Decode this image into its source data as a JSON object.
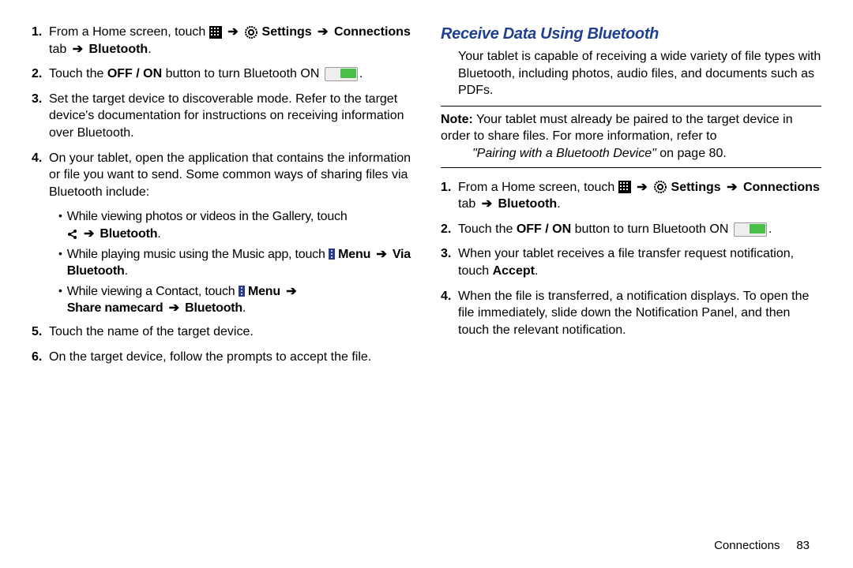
{
  "left": {
    "items": [
      {
        "num": "1.",
        "pre": "From a Home screen, touch ",
        "settings": "Settings",
        "conn_tab": "Connections",
        "tab_word": " tab ",
        "bt": "Bluetooth",
        "tail": "."
      },
      {
        "num": "2.",
        "pre": "Touch the ",
        "offon": "OFF / ON",
        "mid": " button to turn Bluetooth ON ",
        "tail": "."
      },
      {
        "num": "3.",
        "text": "Set the target device to discoverable mode. Refer to the target device's documentation for instructions on receiving information over Bluetooth."
      },
      {
        "num": "4.",
        "text": "On your tablet, open the application that contains the information or file you want to send. Some common ways of sharing files via Bluetooth include:"
      }
    ],
    "bullets": [
      {
        "pre": "While viewing photos or videos in the Gallery, touch ",
        "bt": "Bluetooth",
        "tail": "."
      },
      {
        "pre": "While playing music using the Music app, touch ",
        "menu": "Menu",
        "via": "Via Bluetooth",
        "tail": "."
      },
      {
        "pre": "While viewing a Contact, touch ",
        "menu": "Menu",
        "share": "Share namecard",
        "bt": "Bluetooth",
        "tail": "."
      }
    ],
    "items2": [
      {
        "num": "5.",
        "text": "Touch the name of the target device."
      },
      {
        "num": "6.",
        "text": "On the target device, follow the prompts to accept the file."
      }
    ]
  },
  "right": {
    "heading": "Receive Data Using Bluetooth",
    "intro": "Your tablet is capable of receiving a wide variety of file types with Bluetooth, including photos, audio files, and documents such as PDFs.",
    "note": {
      "label": "Note:",
      "body": " Your tablet must already be paired to the target device in order to share files. For more information, refer to ",
      "ref": "\"Pairing with a Bluetooth Device\"",
      "onpage": " on page 80."
    },
    "items": [
      {
        "num": "1.",
        "pre": "From a Home screen, touch ",
        "settings": "Settings",
        "conn_tab": "Connections",
        "tab_word": " tab ",
        "bt": "Bluetooth",
        "tail": "."
      },
      {
        "num": "2.",
        "pre": "Touch the ",
        "offon": "OFF / ON",
        "mid": " button to turn Bluetooth ON ",
        "tail": "."
      },
      {
        "num": "3.",
        "pre": "When your tablet receives a file transfer request notification, touch ",
        "accept": "Accept",
        "tail": "."
      },
      {
        "num": "4.",
        "text": "When the file is transferred, a notification displays. To open the file immediately, slide down the Notification Panel, and then touch the relevant notification."
      }
    ]
  },
  "footer": {
    "section": "Connections",
    "page": "83"
  },
  "glyphs": {
    "arrow": "➔"
  }
}
